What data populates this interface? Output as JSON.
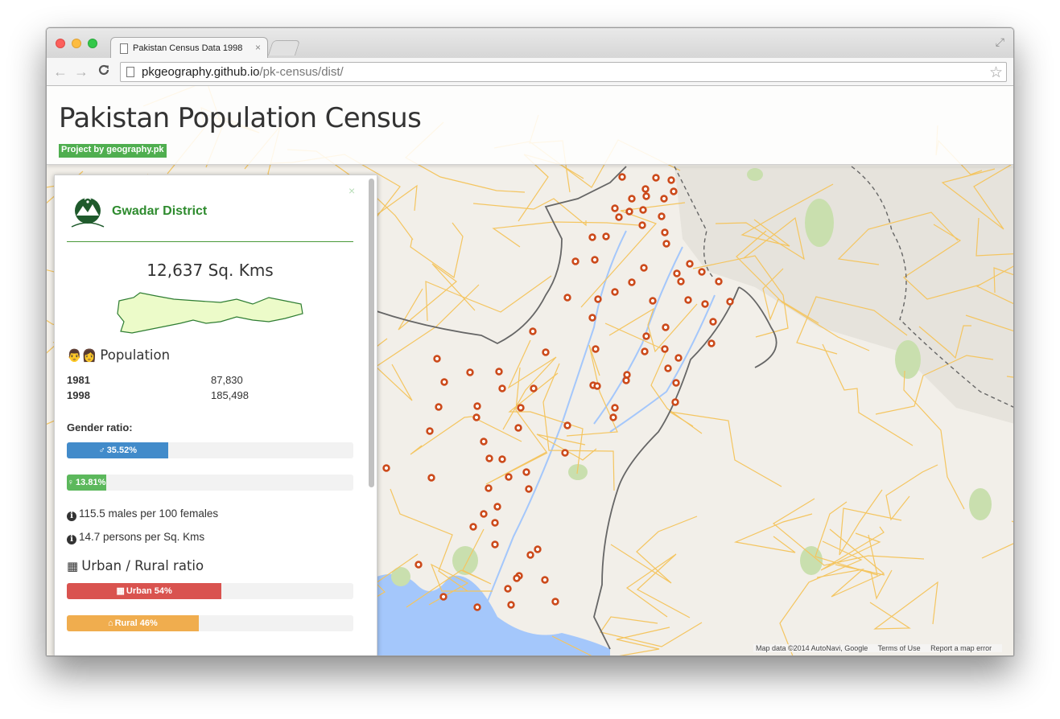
{
  "browser": {
    "tab_title": "Pakistan Census Data 1998",
    "tab_close": "×",
    "url_host": "pkgeography.github.io",
    "url_path": "/pk-census/dist/",
    "back_glyph": "←",
    "forward_glyph": "→",
    "reload_glyph": "C",
    "star_glyph": "☆",
    "fullscreen_glyph": "⤢"
  },
  "header": {
    "title": "Pakistan Population Census",
    "badge": "Project by geography.pk"
  },
  "panel": {
    "close_glyph": "×",
    "district_name": "Gwadar District",
    "area": "12,637 Sq. Kms",
    "population_heading": "Population",
    "population_icon": "👨👩",
    "population": [
      {
        "year": "1981",
        "count": "87,830"
      },
      {
        "year": "1998",
        "count": "185,498"
      }
    ],
    "gender_label": "Gender ratio:",
    "male_bar": {
      "label": "35.52%",
      "percent": 35.52,
      "color": "#428bca",
      "icon": "male-icon"
    },
    "female_bar": {
      "label": "13.81%",
      "percent": 13.81,
      "color": "#5cb85c",
      "icon": "female-icon"
    },
    "info_icon_glyph": "i",
    "males_per_females": "115.5 males per 100 females",
    "density": "14.7 persons per Sq. Kms",
    "urban_rural_heading": "Urban / Rural ratio",
    "urban_bar": {
      "label": "Urban 54%",
      "percent": 54,
      "color": "#d9534f",
      "icon": "building-icon"
    },
    "rural_bar": {
      "label": "Rural 46%",
      "percent": 46,
      "color": "#f0ad4e",
      "icon": "home-icon"
    }
  },
  "map": {
    "attribution": "Map data ©2014 AutoNavi, Google",
    "terms": "Terms of Use",
    "report": "Report a map error",
    "marker_color": "#cc4a1b",
    "road_color": "#f4c560",
    "water_color": "#a4c7fb",
    "park_color": "#c9dfae",
    "border_color": "#666666"
  }
}
